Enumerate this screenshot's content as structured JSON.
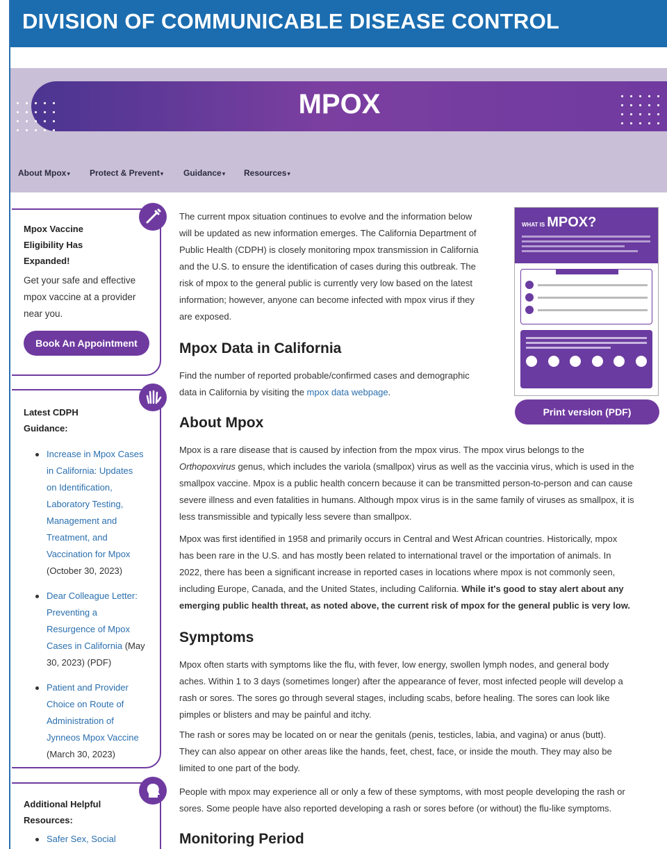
{
  "header": {
    "title": "DIVISION OF COMMUNICABLE DISEASE CONTROL"
  },
  "hero": {
    "title": "MPOX"
  },
  "nav": {
    "items": [
      {
        "label": "About Mpox"
      },
      {
        "label": "Protect & Prevent"
      },
      {
        "label": "Guidance"
      },
      {
        "label": "Resources"
      }
    ],
    "caret": "▾"
  },
  "sidebar": {
    "vaccine": {
      "title_lines": [
        "Mpox Vaccine",
        "Eligibility Has",
        "Expanded!"
      ],
      "text_lines": [
        "Get your safe and effective",
        "mpox vaccine at a provider",
        "near you."
      ],
      "button": "Book An Appointment",
      "icon": "syringe-icon"
    },
    "guidance": {
      "title_lines": [
        "Latest CDPH",
        "Guidance:"
      ],
      "icon": "gloved-hand-icon",
      "items": [
        {
          "link_lines": [
            "Increase in Mpox Cases",
            "in California: Updates",
            "on Identification,",
            "Laboratory Testing,",
            "Management and",
            "Treatment, and",
            "Vaccination for Mpox"
          ],
          "note_lines": [
            "(October 30, 2023)"
          ]
        },
        {
          "link_lines": [
            "Dear Colleague Letter:",
            "Preventing a",
            "Resurgence of Mpox",
            "Cases in California"
          ],
          "inline_note": " (May",
          "note_lines": [
            "30, 2023) (PDF)"
          ]
        },
        {
          "link_lines": [
            "Patient and Provider",
            "Choice on Route of",
            "Administration of",
            "Jynneos Mpox Vaccine"
          ],
          "note_lines": [
            "(March 30, 2023)"
          ]
        }
      ]
    },
    "resources": {
      "title_lines": [
        "Additional Helpful",
        "Resources:"
      ],
      "icon": "person-head-icon",
      "items": [
        {
          "link": "Safer Sex, Social"
        }
      ]
    }
  },
  "main": {
    "intro_lines": [
      "The current mpox situation continues to evolve and the information below",
      "will be updated as new information emerges. The California Department of",
      "Public Health (CDPH) is closely monitoring mpox transmission in California",
      "and the U.S. to ensure the identification of cases during this outbreak. The",
      "risk of mpox to the general public is currently very low based on the latest",
      "information; however, anyone can become infected with mpox virus if they",
      "are exposed."
    ],
    "data_heading": "Mpox Data in California",
    "data_line1": "Find the number of reported probable/confirmed cases and demographic",
    "data_line2_pre": "data in California by visiting the ",
    "data_link": "mpox data webpage",
    "data_line2_post": ".",
    "about_heading": "About Mpox",
    "about_p1": {
      "l1": "Mpox is a rare disease that is caused by infection from the mpox virus. The mpox virus belongs to the",
      "l2_italic": "Orthopoxvirus",
      "l2_rest": " genus, which includes the variola (smallpox) virus as well as the vaccinia virus, which is used in the",
      "l3": "smallpox vaccine. Mpox is a public health concern because it can be transmitted person-to-person and can cause",
      "l4": "severe illness and even fatalities in humans. Although mpox virus is in the same family of viruses as smallpox, it is",
      "l5": "less transmissible and typically less severe than smallpox."
    },
    "about_p2": {
      "l1": "Mpox was first identified in 1958 and primarily occurs in Central and West African countries. Historically, mpox",
      "l2": "has been rare in the U.S. and has mostly been related to international travel or the importation of animals. In",
      "l3": "2022, there has been a significant increase in reported cases in locations where mpox is not commonly seen,",
      "l4_pre": "including Europe, Canada, and the United States, including California. ",
      "l4_bold": "While it's good to stay alert about any",
      "l5_bold": "emerging public health threat, as noted above, the current risk of mpox for the general public is very low."
    },
    "symptoms_heading": "Symptoms",
    "symptoms_p1": [
      "Mpox often starts with symptoms like the flu, with fever, low energy, swollen lymph nodes, and general body",
      "aches. Within 1 to 3 days (sometimes longer) after the appearance of fever, most infected people will develop a",
      "rash or sores. The sores go through several stages, including scabs, before healing. The sores can look like",
      "pimples or blisters and may be painful and itchy."
    ],
    "symptoms_p2": [
      "The rash or sores may be located on or near the genitals (penis, testicles, labia, and vagina) or anus (butt).",
      "They can also appear on other areas like the hands, feet, chest, face, or inside the mouth. They may also be",
      "limited to one part of the body."
    ],
    "symptoms_p3": [
      "People with mpox may experience all or only a few of these symptoms, with most people developing the rash or",
      "sores. Some people have also reported developing a rash or sores before (or without) the flu-like symptoms."
    ],
    "monitoring_heading": "Monitoring Period"
  },
  "infographic": {
    "title_small": "WHAT IS",
    "title": "MPOX?",
    "print_button": "Print version (PDF)"
  },
  "colors": {
    "header_blue": "#1b6db0",
    "purple": "#6f3aa0",
    "lavender": "#c9bfd7",
    "link": "#2a6fae"
  }
}
